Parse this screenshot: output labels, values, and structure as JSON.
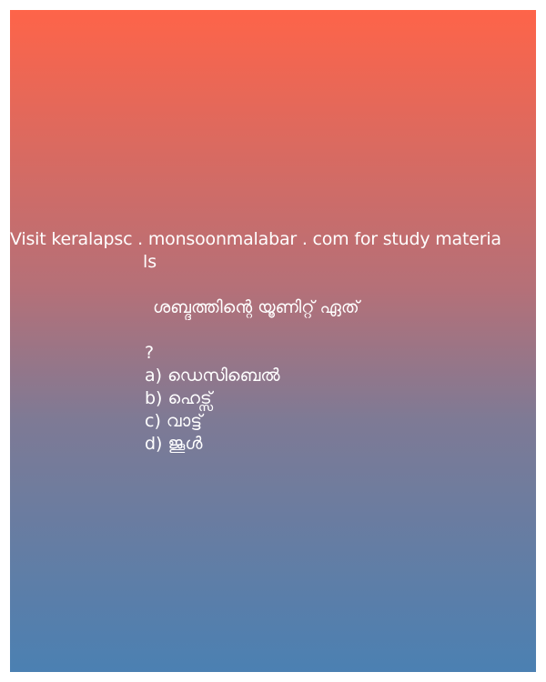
{
  "promo": {
    "line1": "Visit keralapsc . monsoonmalabar . com for study materia",
    "line2": "ls"
  },
  "question": {
    "text": "ശബ്ദത്തിന്റെ യൂണിറ്റ് ഏത്",
    "mark": "?"
  },
  "options": [
    "a) ഡെസിബെൽ",
    "b) ഹെട്സ്",
    "c) വാട്ട്",
    "d) ജൂൾ"
  ],
  "colors": {
    "gradient_top": "#fe6449",
    "gradient_bottom": "#4b80b2",
    "text": "#ffffff"
  }
}
